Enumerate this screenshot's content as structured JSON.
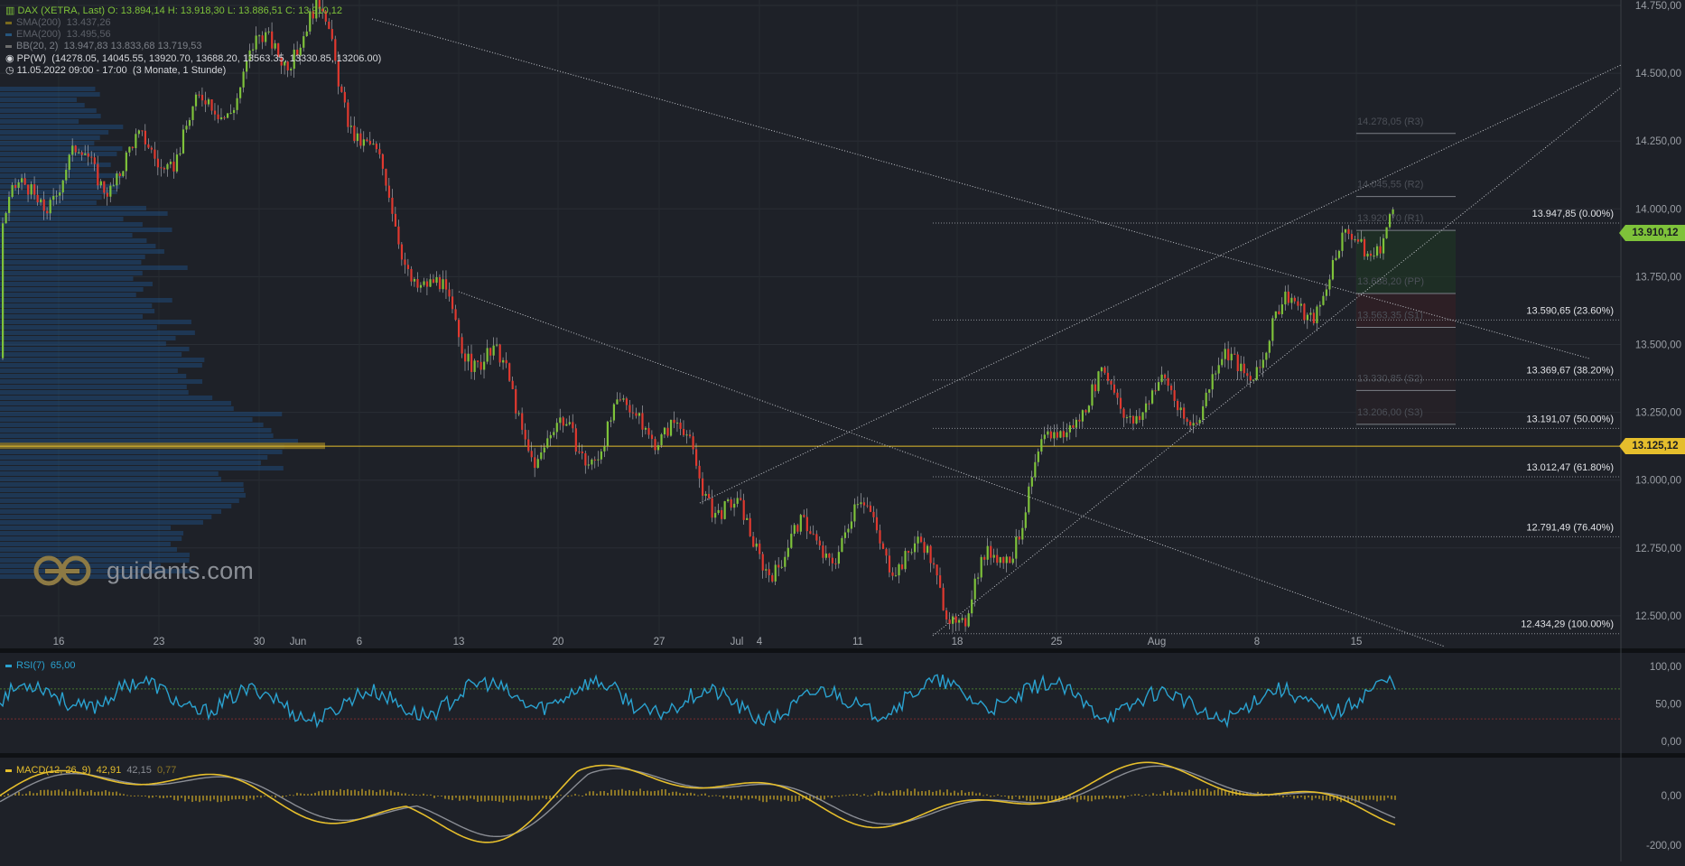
{
  "instrument": {
    "label": "DAX (XETRA, Last)",
    "ohlc": "O: 13.894,14  H: 13.918,30  L: 13.886,51  C: 13.910,12"
  },
  "indicators": [
    {
      "label": "SMA(200)",
      "value": "13.437,26",
      "color": "#7a6a1e"
    },
    {
      "label": "EMA(200)",
      "value": "13.495,56",
      "color": "#26557d"
    },
    {
      "label": "BB(20, 2)",
      "value": "13.947,83  13.833,68  13.719,53",
      "color": "#6d6d6d"
    }
  ],
  "pivot": {
    "label": "PP(W)",
    "values": "(14278.05, 14045.55, 13920.70, 13688.20, 13563.35, 13330.85, 13206.00)"
  },
  "timerange": {
    "label": "11.05.2022 09:00 - 17:00",
    "detail": "(3 Monate, 1 Stunde)"
  },
  "watermark": "guidants.com",
  "price_axis": [
    "14.750,00",
    "14.500,00",
    "14.250,00",
    "14.000,00",
    "13.750,00",
    "13.500,00",
    "13.250,00",
    "13.000,00",
    "12.750,00",
    "12.500,00"
  ],
  "time_axis": [
    "16",
    "23",
    "30",
    "Jun",
    "6",
    "13",
    "20",
    "27",
    "Jul",
    "4",
    "11",
    "18",
    "25",
    "Aug",
    "8",
    "15"
  ],
  "fib_levels": [
    {
      "label": "13.947,85 (0.00%)",
      "value": 13947.85
    },
    {
      "label": "13.590,65 (23.60%)",
      "value": 13590.65
    },
    {
      "label": "13.369,67 (38.20%)",
      "value": 13369.67
    },
    {
      "label": "13.191,07 (50.00%)",
      "value": 13191.07
    },
    {
      "label": "13.012,47 (61.80%)",
      "value": 13012.47
    },
    {
      "label": "12.791,49 (76.40%)",
      "value": 12791.49
    },
    {
      "label": "12.434,29 (100.00%)",
      "value": 12434.29
    }
  ],
  "pivot_levels": [
    {
      "label": "14.278,05 (R3)",
      "value": 14278.05
    },
    {
      "label": "14.045,55 (R2)",
      "value": 14045.55
    },
    {
      "label": "13.920,70 (R1)",
      "value": 13920.7
    },
    {
      "label": "13.688,20 (PP)",
      "value": 13688.2
    },
    {
      "label": "13.563,35 (S1)",
      "value": 13563.35
    },
    {
      "label": "13.330,85 (S2)",
      "value": 13330.85
    },
    {
      "label": "13.206,00 (S3)",
      "value": 13206.0
    }
  ],
  "last_price": {
    "label": "13.910,12",
    "value": 13910.12,
    "color": "#7ec23a"
  },
  "poc_price": {
    "label": "13.125,12",
    "value": 13125.12,
    "color": "#e5be2c"
  },
  "rsi": {
    "label": "RSI(7)",
    "value": "65,00",
    "axis": [
      "100,00",
      "50,00",
      "0,00"
    ],
    "overbought": 70,
    "oversold": 30
  },
  "macd": {
    "label": "MACD(12, 26, 9)",
    "macd_value": "42,91",
    "signal_value": "42,15",
    "hist_value": "0,77",
    "axis": [
      "0,00",
      "-200,00"
    ]
  },
  "colors": {
    "up": "#7ec23a",
    "down": "#e0392f",
    "background": "#1e2128",
    "grid": "#2a2e35",
    "volume_profile": "#1f4a78",
    "rsi_line": "#2aa2d0",
    "macd_line": "#e5be2c",
    "signal_line": "#8a8d94",
    "histogram": "#8c7626"
  },
  "chart_data": {
    "type": "line",
    "title": "DAX (XETRA, Last)",
    "xlabel": "",
    "ylabel": "",
    "ylim": [
      12400,
      14750
    ],
    "x": [
      "16",
      "23",
      "30",
      "Jun 6",
      "13",
      "20",
      "27",
      "Jul 4",
      "11",
      "18",
      "25",
      "Aug 1",
      "8",
      "15"
    ],
    "series": [
      {
        "values": [
          13950,
          14150,
          14400,
          14650,
          13700,
          13100,
          13300,
          12700,
          12900,
          12450,
          13350,
          13200,
          13650,
          13910
        ]
      }
    ]
  }
}
